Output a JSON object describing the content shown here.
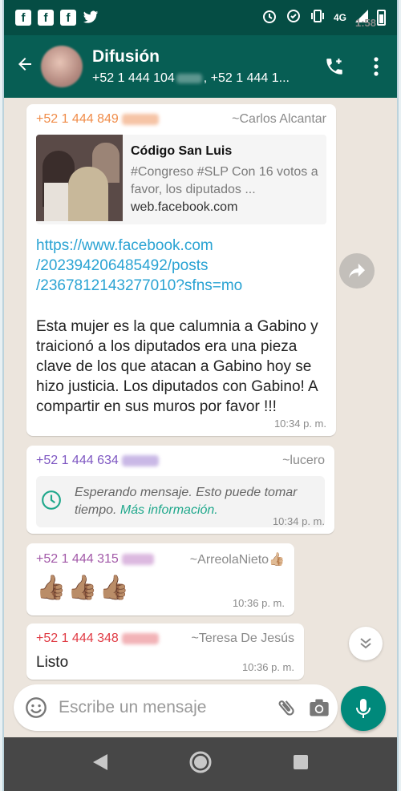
{
  "status_bar": {
    "time": "1:58",
    "network": "4G"
  },
  "header": {
    "title": "Difusión",
    "subtitle_part1": "+52 1 444 104",
    "subtitle_part2": ", +52 1 444 1..."
  },
  "messages": [
    {
      "sender_phone": "+52 1 444 849",
      "sender_name": "~Carlos Alcantar",
      "phone_color": "#f08c49",
      "preview_title": "Código San Luis",
      "preview_desc": "#Congreso #SLP Con 16 votos a favor, los diputados ...",
      "preview_site": "web.facebook.com",
      "link": "https://www.facebook.com/202394206485492/posts/2367812143277010?sfns=mo",
      "link_line1": "https://www.facebook.com",
      "link_line2": "/202394206485492/posts",
      "link_line3": "/2367812143277010?sfns=mo",
      "text": "Esta mujer es la que calumnia a Gabino y traicionó a los diputados era una pieza clave de los que atacan a Gabino hoy se hizo justicia. Los diputados con Gabino! A compartir en sus muros por favor !!!",
      "time": "10:34 p. m."
    },
    {
      "sender_phone": "+52 1 444 634",
      "sender_name": "~lucero",
      "phone_color": "#7e57c2",
      "pending_text": "Esperando mensaje. Esto puede tomar tiempo.",
      "pending_link": "Más información.",
      "time": "10:34 p. m."
    },
    {
      "sender_phone": "+52 1 444 315",
      "sender_name": "~ArreolaNieto👍🏼",
      "phone_color": "#a259a8",
      "text": "👍🏽👍🏽👍🏽",
      "time": "10:36 p. m."
    },
    {
      "sender_phone": "+52 1 444 348",
      "sender_name": "~Teresa De Jesús",
      "phone_color": "#e03b44",
      "text": "Listo",
      "time": "10:36 p. m."
    }
  ],
  "composer": {
    "placeholder": "Escribe un mensaje"
  },
  "colors": {
    "app_bar": "#075e54",
    "status_bar": "#054d44",
    "accent": "#00897b"
  }
}
